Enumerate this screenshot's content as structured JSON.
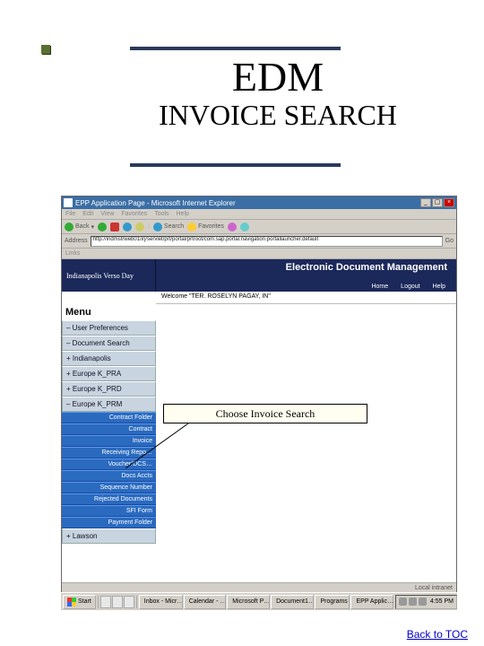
{
  "slide": {
    "title1": "EDM",
    "title2": "INVOICE SEARCH",
    "callout": "Choose Invoice Search",
    "back_link": "Back to TOC"
  },
  "browser": {
    "window_title": "EPP Application Page - Microsoft Internet Explorer",
    "menus": [
      "File",
      "Edit",
      "View",
      "Favorites",
      "Tools",
      "Help"
    ],
    "toolbar": {
      "back": "Back",
      "search": "Search",
      "favorites": "Favorites"
    },
    "address_label": "Address",
    "address_value": "http://indmstrweb01/irj/servlet/prt/portal/prtroot/com.sap.portal.navigation.portallauncher.default",
    "go": "Go",
    "links": "Links"
  },
  "edm": {
    "org": "Indianapolis Verso Day",
    "app_title": "Electronic Document Management",
    "nav": [
      "Home",
      "Logout",
      "Help"
    ],
    "welcome": "Welcome \"TER. ROSELYN PAGAY, IN\""
  },
  "menu": {
    "heading": "Menu",
    "groups": [
      "– User Preferences",
      "– Document Search",
      "+ Indianapolis",
      "+ Europe K_PRA",
      "+ Europe K_PRD",
      "– Europe K_PRM"
    ],
    "subs": [
      "Contract Folder",
      "Contract",
      "Invoice",
      "Receiving Repo…",
      "Voucher/DCS…",
      "Docs Accts",
      "Sequence Number",
      "Rejected Documents",
      "SFI Form",
      "Payment Folder"
    ],
    "lawson": "+ Lawson"
  },
  "statusbar": {
    "left": "",
    "right": "Local intranet"
  },
  "taskbar": {
    "start": "Start",
    "buttons": [
      "Inbox - Micr…",
      "Calendar - …",
      "Microsoft P…",
      "Document1…",
      "Programs",
      "EPP Applic…"
    ],
    "clock": "4:55 PM"
  }
}
